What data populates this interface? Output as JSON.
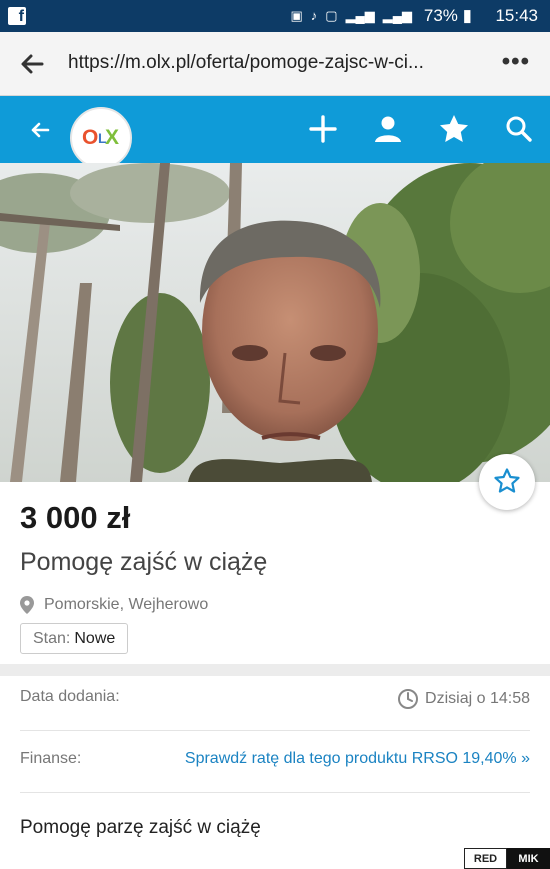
{
  "status_bar": {
    "app_icon": "facebook-icon",
    "battery": "73%",
    "time": "15:43",
    "color": "#0d3b66"
  },
  "browser": {
    "url": "https://m.olx.pl/oferta/pomoge-zajsc-w-ci...",
    "back_icon": "arrow-left-icon",
    "menu_icon": "more-dots-icon"
  },
  "app_header": {
    "logo": "OLX",
    "accent": "#0f9bd8",
    "actions": [
      "plus-icon",
      "user-icon",
      "star-icon",
      "search-icon"
    ]
  },
  "listing": {
    "price": "3 000 zł",
    "title": "Pomogę zajść w ciążę",
    "location": "Pomorskie, Wejherowo",
    "condition_label": "Stan:",
    "condition_value": "Nowe",
    "details": {
      "date_label": "Data dodania:",
      "date_value": "Dzisiaj o 14:58",
      "finance_label": "Finanse:",
      "finance_value": "Sprawdź ratę dla tego produktu RRSO 19,40% »"
    },
    "description": "Pomogę parzę zajść w ciążę"
  },
  "watermark": {
    "left": "RED",
    "right": "MIK"
  }
}
